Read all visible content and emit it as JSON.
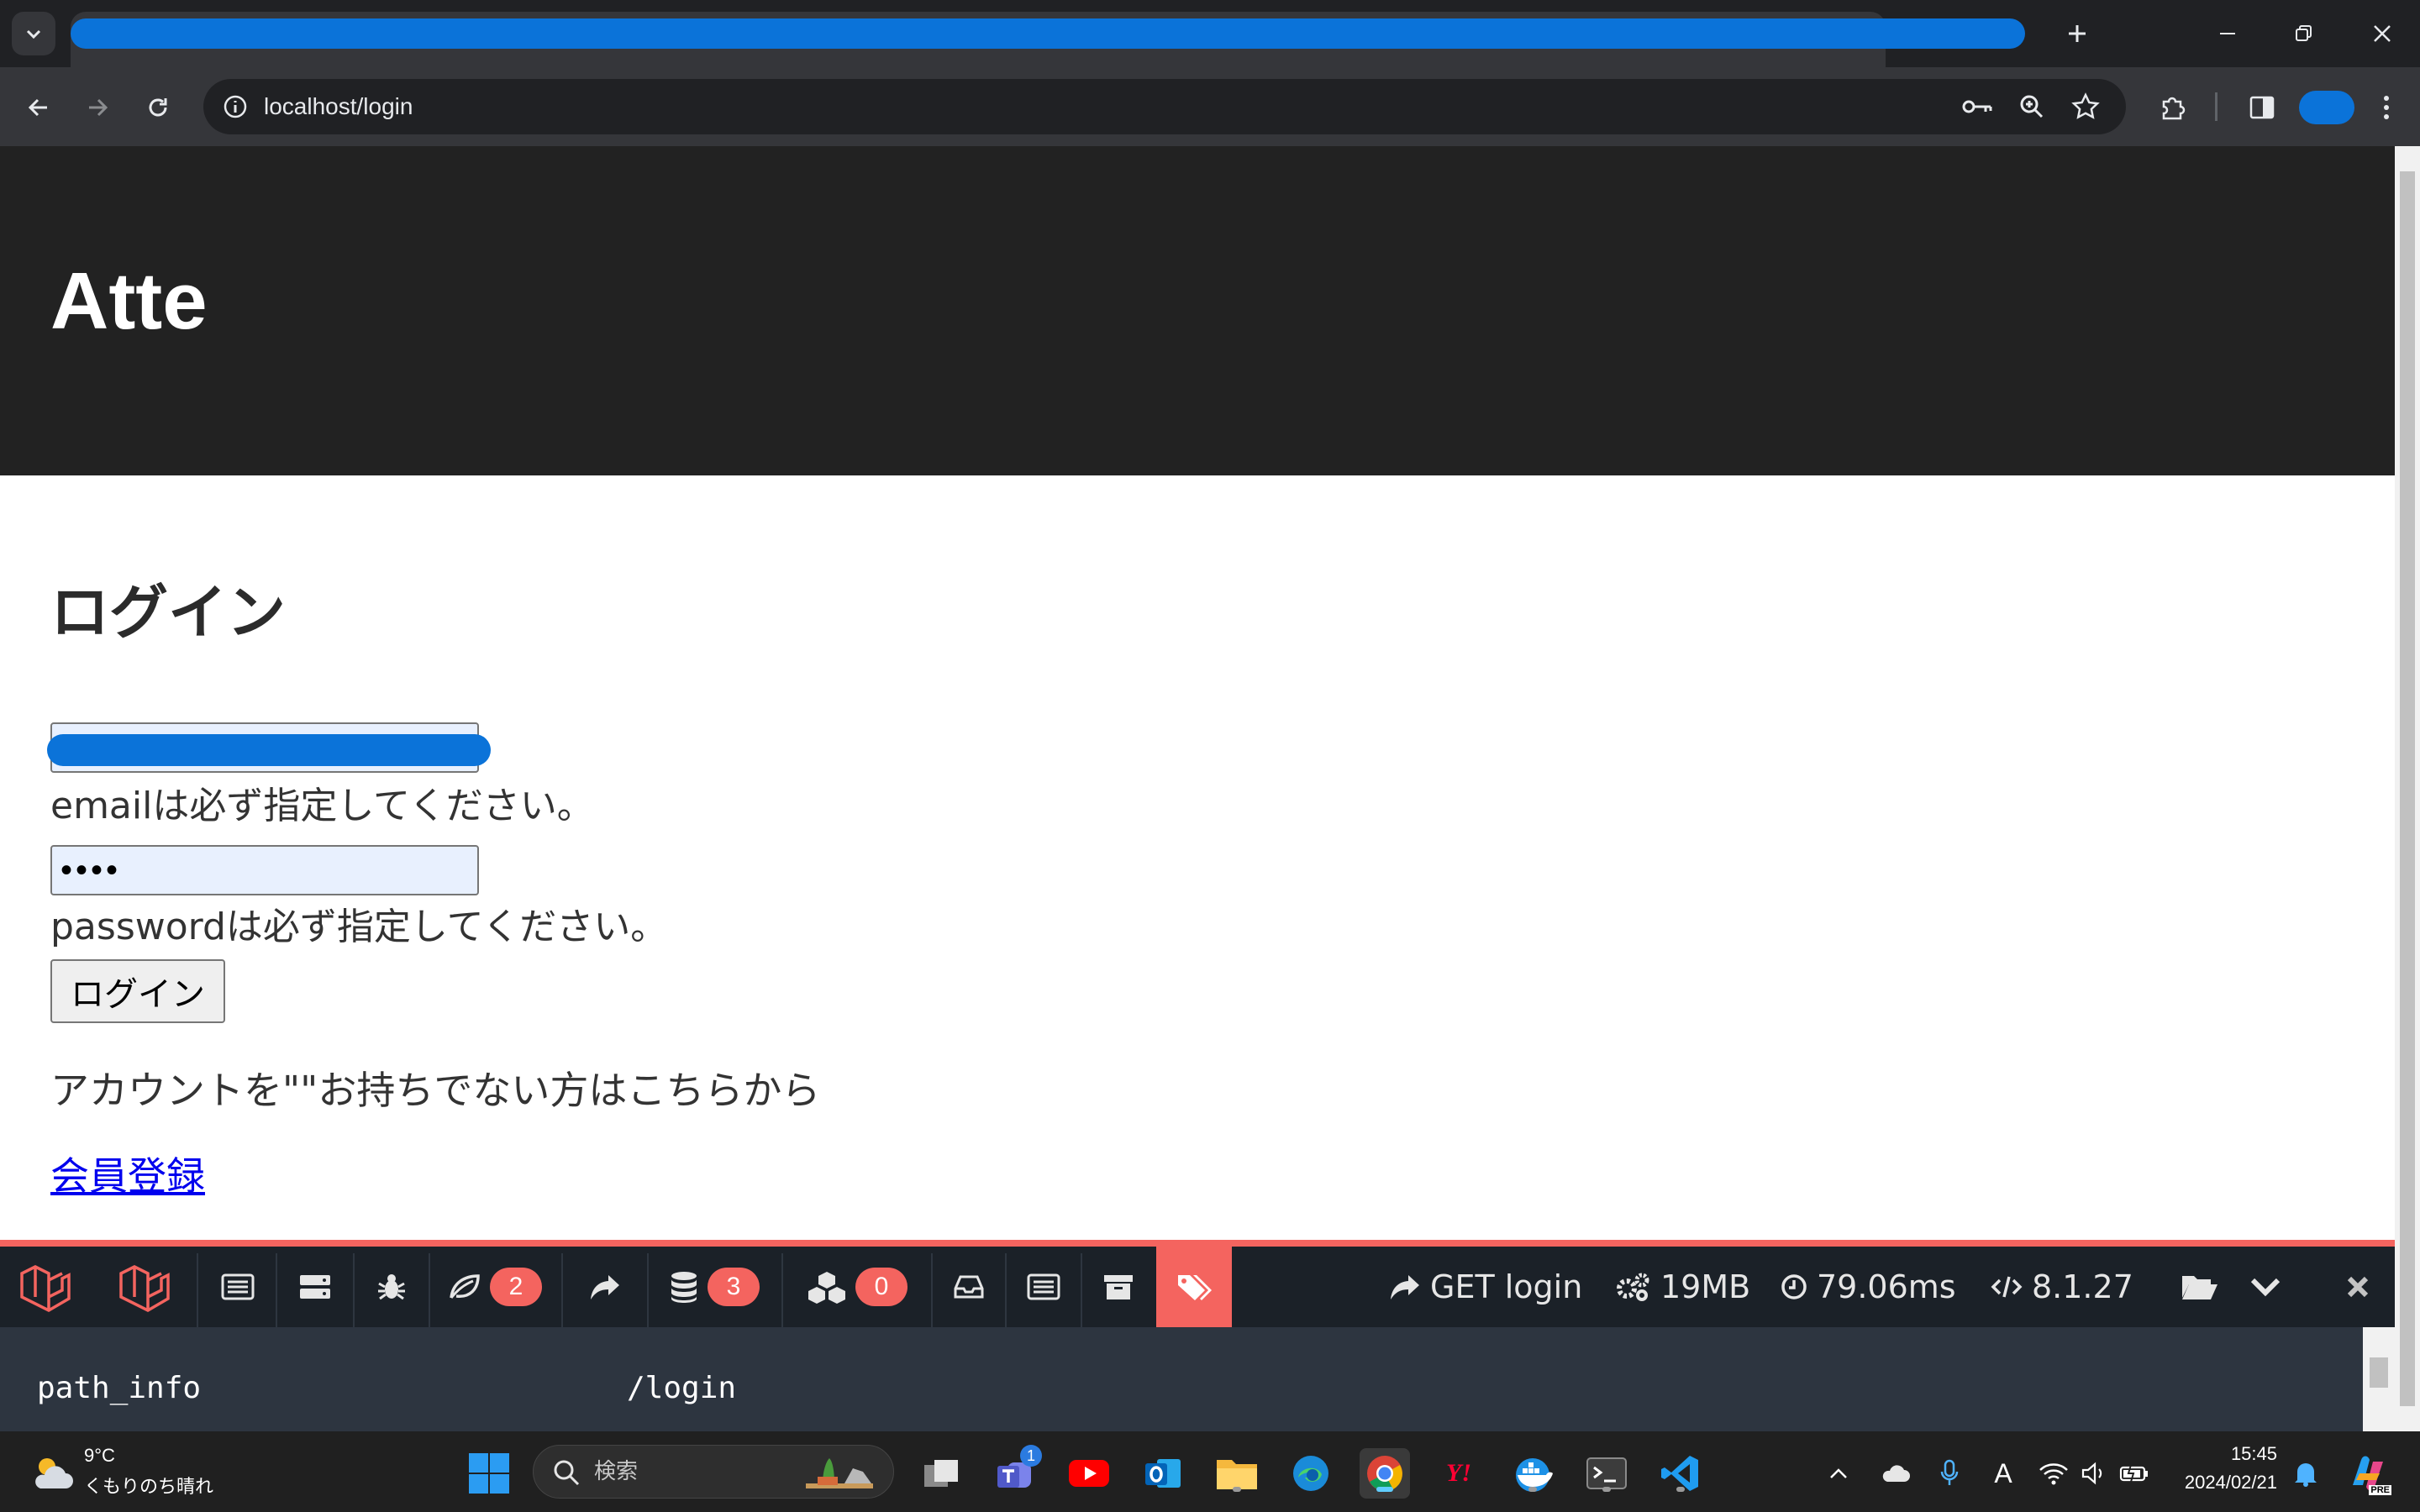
{
  "browser": {
    "address": "localhost/login",
    "icons": {
      "tab_search": "chevron-down-icon",
      "new_tab": "plus-icon",
      "back": "arrow-left-icon",
      "forward": "arrow-right-icon",
      "reload": "reload-icon",
      "site_info": "info-icon",
      "password": "key-icon",
      "zoom": "zoom-icon",
      "bookmark": "star-icon",
      "extensions": "puzzle-icon",
      "side_panel": "side-panel-icon",
      "menu": "kebab-menu-icon"
    }
  },
  "page": {
    "site_title": "Atte",
    "heading": "ログイン",
    "email_error": "emailは必ず指定してください。",
    "password_value": "••••",
    "password_error": "passwordは必ず指定してください。",
    "login_button": "ログイン",
    "no_account_text": "アカウントを\"\"お持ちでない方はこちらから",
    "register_link": "会員登録"
  },
  "debugbar": {
    "badges": {
      "views": "2",
      "queries": "3",
      "models": "0"
    },
    "route": "GET login",
    "memory": "19MB",
    "duration": "79.06ms",
    "php_version": "8.1.27",
    "panel": {
      "key": "path_info",
      "value": "/login"
    },
    "colors": {
      "accent": "#f4645f",
      "bar_bg": "#1b2128",
      "panel_bg": "#2d3540"
    }
  },
  "taskbar": {
    "weather_temp": "9°C",
    "weather_desc": "くもりのち晴れ",
    "search_placeholder": "検索",
    "teams_badge": "1",
    "time": "15:45",
    "date": "2024/02/21",
    "ime_label": "A",
    "yahoo_label": "Y!",
    "copilot_label": "PRE"
  },
  "colors": {
    "header_bg": "#222222",
    "link": "#0000ee",
    "input_bg": "#e8f0fe"
  }
}
